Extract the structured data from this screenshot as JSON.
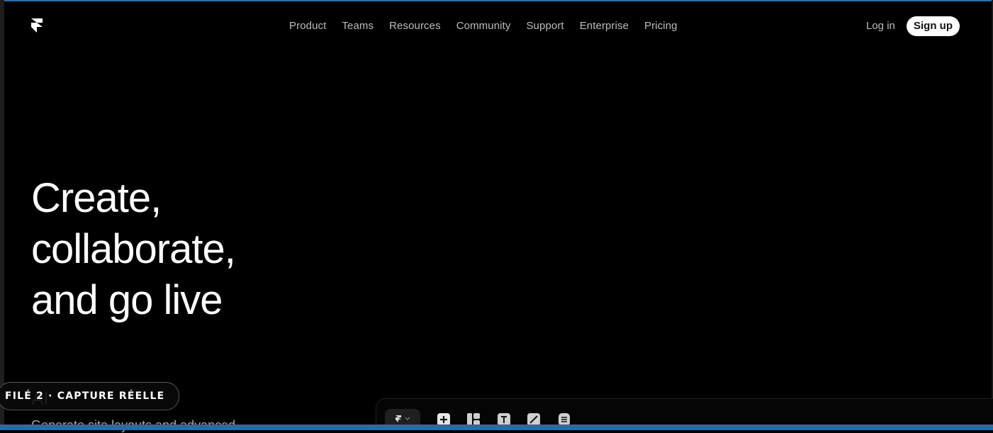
{
  "nav": {
    "items": [
      "Product",
      "Teams",
      "Resources",
      "Community",
      "Support",
      "Enterprise",
      "Pricing"
    ],
    "login": "Log in",
    "signup": "Sign up"
  },
  "hero": {
    "line1": "Create,",
    "line2": "collaborate,",
    "line3": "and go live"
  },
  "feature": {
    "label": "AI",
    "description": "Generate site layouts and advanced"
  },
  "overlay": {
    "badge": "FILÉ 2 · CAPTURE RÉELLE"
  },
  "toolbar": {
    "icons": [
      "framer-menu-icon",
      "insert-icon",
      "layout-icon",
      "text-icon",
      "vector-icon",
      "cms-icon"
    ]
  },
  "colors": {
    "background": "#000000",
    "nav_text": "#bdbdbd",
    "signup_bg": "#ffffff",
    "frame_accent": "#2a6aa5"
  }
}
